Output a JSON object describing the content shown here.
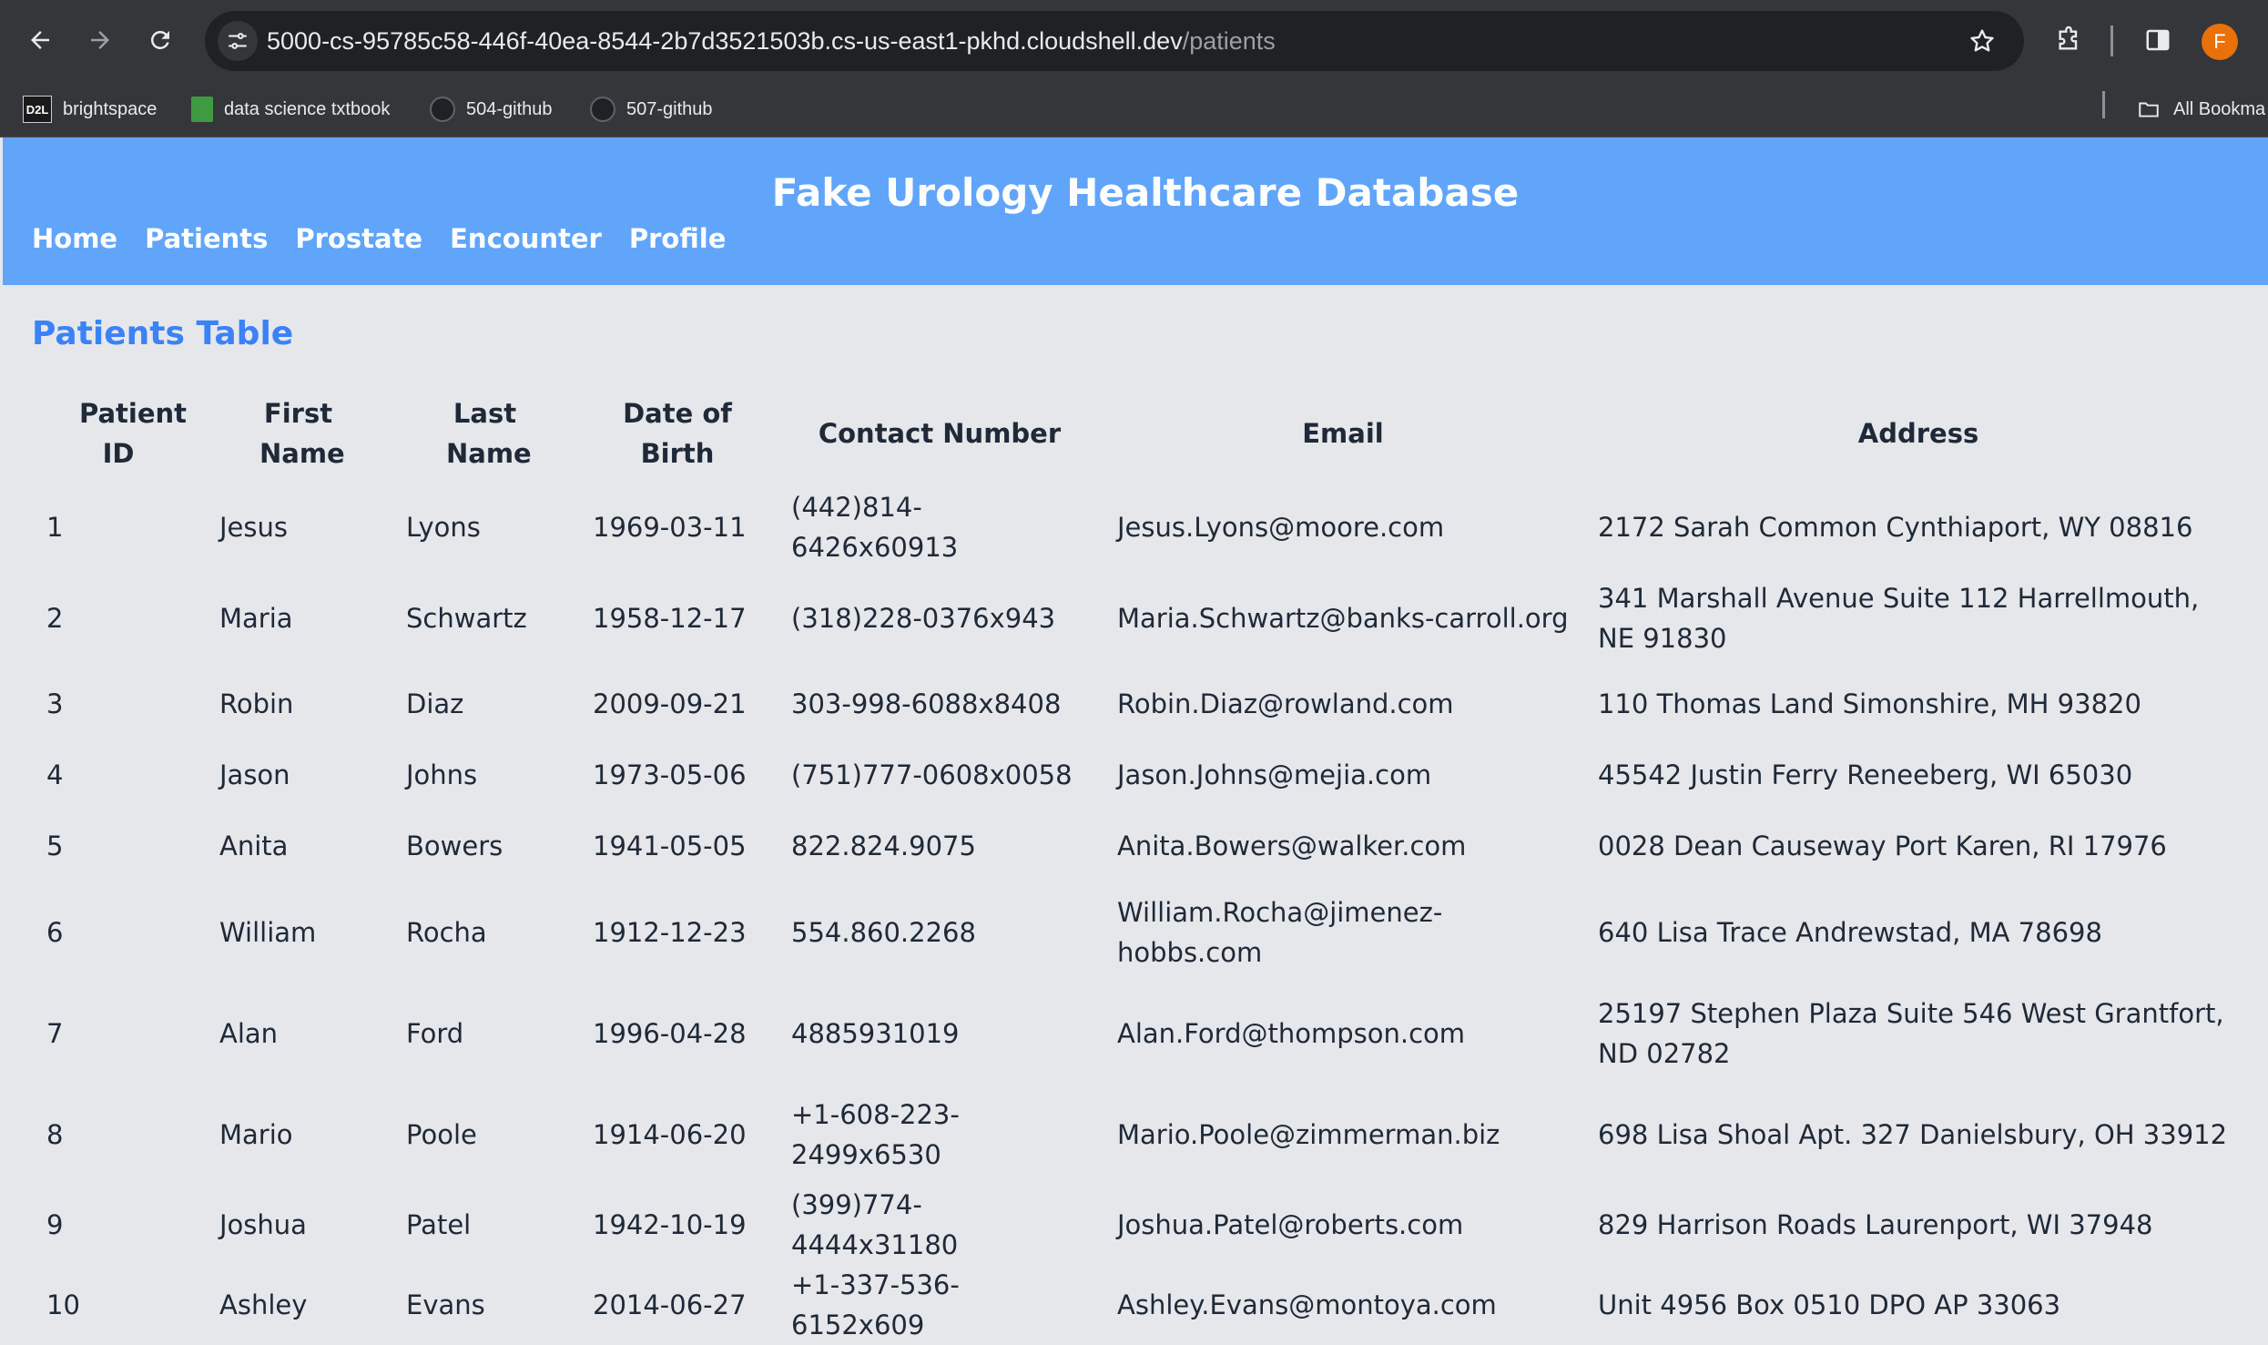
{
  "browser": {
    "url_host": "5000-cs-95785c58-446f-40ea-8544-2b7d3521503b.cs-us-east1-pkhd.cloudshell.dev",
    "url_path": "/patients",
    "avatar_letter": "F",
    "bookmarks": [
      {
        "label": "brightspace",
        "icon": "d2l-icon"
      },
      {
        "label": "data science txtbook",
        "icon": "book-icon"
      },
      {
        "label": "504-github",
        "icon": "github-icon"
      },
      {
        "label": "507-github",
        "icon": "github-icon"
      }
    ],
    "all_bookmarks_label": "All Bookma"
  },
  "app": {
    "title": "Fake Urology Healthcare Database",
    "nav": [
      "Home",
      "Patients",
      "Prostate",
      "Encounter",
      "Profile"
    ],
    "header_color": "#60a5fa",
    "accent_color": "#3b82f6"
  },
  "table": {
    "title": "Patients Table",
    "headers": [
      "Patient ID",
      "First Name",
      "Last Name",
      "Date of Birth",
      "Contact Number",
      "Email",
      "Address"
    ],
    "rows": [
      [
        "1",
        "Jesus",
        "Lyons",
        "1969-03-11",
        "(442)814-6426x60913",
        "Jesus.Lyons@moore.com",
        "2172 Sarah Common Cynthiaport, WY 08816"
      ],
      [
        "2",
        "Maria",
        "Schwartz",
        "1958-12-17",
        "(318)228-0376x943",
        "Maria.Schwartz@banks-carroll.org",
        "341 Marshall Avenue Suite 112 Harrellmouth, NE 91830"
      ],
      [
        "3",
        "Robin",
        "Diaz",
        "2009-09-21",
        "303-998-6088x8408",
        "Robin.Diaz@rowland.com",
        "110 Thomas Land Simonshire, MH 93820"
      ],
      [
        "4",
        "Jason",
        "Johns",
        "1973-05-06",
        "(751)777-0608x0058",
        "Jason.Johns@mejia.com",
        "45542 Justin Ferry Reneeberg, WI 65030"
      ],
      [
        "5",
        "Anita",
        "Bowers",
        "1941-05-05",
        "822.824.9075",
        "Anita.Bowers@walker.com",
        "0028 Dean Causeway Port Karen, RI 17976"
      ],
      [
        "6",
        "William",
        "Rocha",
        "1912-12-23",
        "554.860.2268",
        "William.Rocha@jimenez-hobbs.com",
        "640 Lisa Trace Andrewstad, MA 78698"
      ],
      [
        "7",
        "Alan",
        "Ford",
        "1996-04-28",
        "4885931019",
        "Alan.Ford@thompson.com",
        "25197 Stephen Plaza Suite 546 West Grantfort, ND 02782"
      ],
      [
        "8",
        "Mario",
        "Poole",
        "1914-06-20",
        "+1-608-223-2499x6530",
        "Mario.Poole@zimmerman.biz",
        "698 Lisa Shoal Apt. 327 Danielsbury, OH 33912"
      ],
      [
        "9",
        "Joshua",
        "Patel",
        "1942-10-19",
        "(399)774-4444x31180",
        "Joshua.Patel@roberts.com",
        "829 Harrison Roads Laurenport, WI 37948"
      ],
      [
        "10",
        "Ashley",
        "Evans",
        "2014-06-27",
        "+1-337-536-6152x609",
        "Ashley.Evans@montoya.com",
        "Unit 4956 Box 0510 DPO AP 33063"
      ]
    ]
  }
}
